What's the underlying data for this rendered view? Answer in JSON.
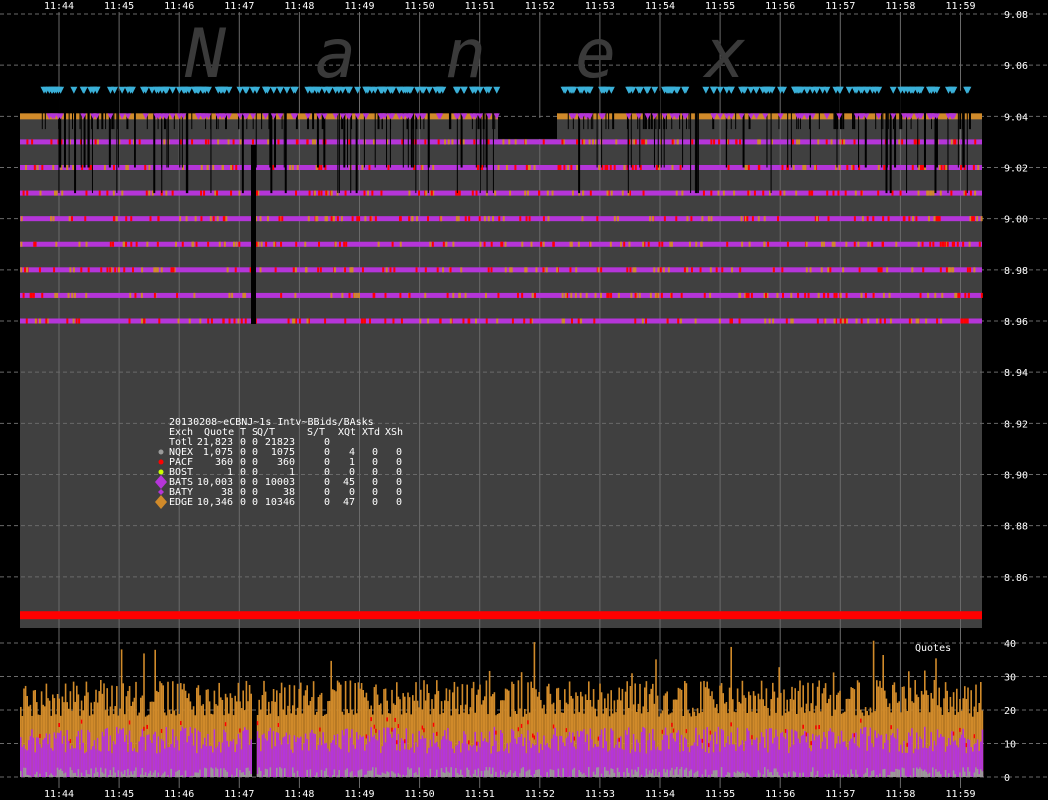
{
  "watermark": [
    "N",
    "a",
    "n",
    "e",
    "x"
  ],
  "colors": {
    "background": "#000000",
    "plot": "#404040",
    "grid": "#6a6a6a",
    "bats": "#b535d9",
    "edge": "#d08a2a",
    "offer": "#3ab0d8",
    "pacf": "#ff0000",
    "nqex": "#9a9a9a",
    "bost": "#ccff00",
    "text": "#ffffff"
  },
  "chart_data": [
    {
      "type": "line",
      "panel": "quotes",
      "x_ticks": [
        "11:44",
        "11:45",
        "11:46",
        "11:47",
        "11:48",
        "11:49",
        "11:50",
        "11:51",
        "11:52",
        "11:53",
        "11:54",
        "11:55",
        "11:56",
        "11:57",
        "11:58",
        "11:59"
      ],
      "y_ticks": [
        "9.08",
        "9.06",
        "9.04",
        "9.02",
        "9.00",
        "8.98",
        "8.96",
        "8.94",
        "8.92",
        "8.90",
        "8.88",
        "8.86"
      ],
      "ylim": [
        8.84,
        9.08
      ],
      "grid": true,
      "series": [
        {
          "name": "BATS",
          "levels": [
            9.03,
            9.02,
            9.01,
            9.0,
            8.99,
            8.98,
            8.97,
            8.96
          ]
        },
        {
          "name": "EDGE",
          "levels": [
            9.04
          ]
        },
        {
          "name": "PACF",
          "levels": [
            8.845
          ]
        }
      ],
      "offer_level": 9.05,
      "legend": {
        "placement": "center-left",
        "title": "20130208~eCBNJ~1s Intv~BBids/BAsks",
        "columns": [
          "Exch",
          "Quote",
          "T",
          "S",
          "Q/T",
          "S/T",
          "XQt",
          "XTd",
          "XSh"
        ],
        "rows": [
          {
            "exch": "Totl",
            "quote": "21,823",
            "t": "0",
            "s": "0",
            "qt": "21823",
            "st": "0",
            "xqt": "",
            "xtd": "",
            "xsh": "",
            "marker": "",
            "color": ""
          },
          {
            "exch": "NQEX",
            "quote": "1,075",
            "t": "0",
            "s": "0",
            "qt": "1075",
            "st": "0",
            "xqt": "4",
            "xtd": "0",
            "xsh": "0",
            "marker": "dot",
            "color": "#9a9a9a"
          },
          {
            "exch": "PACF",
            "quote": "360",
            "t": "0",
            "s": "0",
            "qt": "360",
            "st": "0",
            "xqt": "1",
            "xtd": "0",
            "xsh": "0",
            "marker": "dot",
            "color": "#ff0000"
          },
          {
            "exch": "BOST",
            "quote": "1",
            "t": "0",
            "s": "0",
            "qt": "1",
            "st": "0",
            "xqt": "0",
            "xtd": "0",
            "xsh": "0",
            "marker": "dot",
            "color": "#ccff00"
          },
          {
            "exch": "BATS",
            "quote": "10,003",
            "t": "0",
            "s": "0",
            "qt": "10003",
            "st": "0",
            "xqt": "45",
            "xtd": "0",
            "xsh": "0",
            "marker": "diamond-large",
            "color": "#b535d9"
          },
          {
            "exch": "BATY",
            "quote": "38",
            "t": "0",
            "s": "0",
            "qt": "38",
            "st": "0",
            "xqt": "0",
            "xtd": "0",
            "xsh": "0",
            "marker": "diamond-small",
            "color": "#b535d9"
          },
          {
            "exch": "EDGE",
            "quote": "10,346",
            "t": "0",
            "s": "0",
            "qt": "10346",
            "st": "0",
            "xqt": "47",
            "xtd": "0",
            "xsh": "0",
            "marker": "diamond-large",
            "color": "#d08a2a"
          }
        ]
      }
    },
    {
      "type": "area",
      "panel": "volume",
      "label": "Quotes",
      "y_ticks": [
        "40",
        "30",
        "20",
        "10",
        "0"
      ],
      "ylim": [
        0,
        40
      ],
      "grid": true,
      "series": [
        {
          "name": "EDGE",
          "approx_level": 20
        },
        {
          "name": "BATS",
          "approx_level": 12
        },
        {
          "name": "NQEX",
          "approx_level": 2
        }
      ]
    }
  ]
}
